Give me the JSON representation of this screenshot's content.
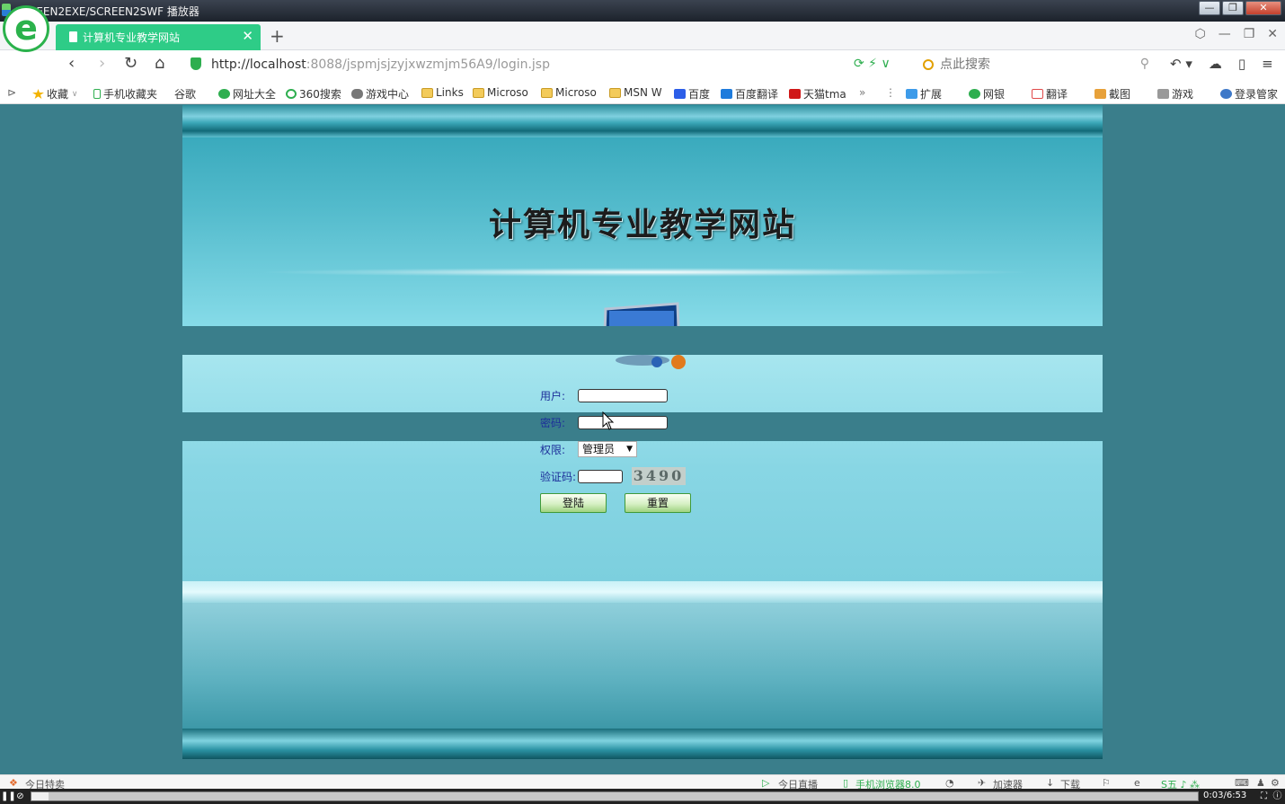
{
  "window": {
    "title": "SCREEN2EXE/SCREEN2SWF 播放器",
    "minimize": "—",
    "restore": "❐",
    "close": "✕"
  },
  "tabs": [
    {
      "title": "计算机专业教学网站",
      "close": "✕",
      "active": true
    }
  ],
  "new_tab": "+",
  "browser_logo": "e",
  "tab_icons": [
    "shirt-icon",
    "minimize-icon",
    "restore-icon",
    "close-icon"
  ],
  "nav": {
    "back": "‹",
    "forward": "›",
    "refresh": "↻",
    "home": "⌂",
    "url_host": "http://localhost",
    "url_rest": ":8088/jspmjsjzyjxwzmjm56A9/login.jsp",
    "url_tools": "⟳ ⚡  ∨",
    "search_placeholder": "点此搜索",
    "search_icon": "⚲",
    "undo": "↶ ▾",
    "cloud": "☁",
    "phone": "▯",
    "menu": "≡"
  },
  "bookmarks": [
    {
      "label": "收藏",
      "icon": "star",
      "suffix": "∨"
    },
    {
      "label": "手机收藏夹",
      "icon": "phone"
    },
    {
      "label": "谷歌",
      "icon": "page"
    },
    {
      "label": "网址大全",
      "icon": "globe"
    },
    {
      "label": "360搜索",
      "icon": "ring"
    },
    {
      "label": "游戏中心",
      "icon": "game"
    },
    {
      "label": "Links",
      "icon": "folder"
    },
    {
      "label": "Microso",
      "icon": "folder"
    },
    {
      "label": "Microso",
      "icon": "folder"
    },
    {
      "label": "MSN W",
      "icon": "folder"
    },
    {
      "label": "百度",
      "icon": "paw"
    },
    {
      "label": "百度翻译",
      "icon": "yi"
    },
    {
      "label": "天猫tma",
      "icon": "tm"
    }
  ],
  "bookmarks_more": "»",
  "bookmark_tools": [
    {
      "label": "扩展",
      "icon": "ext"
    },
    {
      "label": "网银",
      "icon": "bank"
    },
    {
      "label": "翻译",
      "icon": "fy"
    },
    {
      "label": "截图",
      "icon": "cut"
    },
    {
      "label": "游戏",
      "icon": "game2"
    },
    {
      "label": "登录管家",
      "icon": "key"
    }
  ],
  "site": {
    "title": "计算机专业教学网站"
  },
  "login_form": {
    "user_label": "用户:",
    "user_value": "",
    "password_label": "密码:",
    "password_value": "",
    "role_label": "权限:",
    "role_value": "管理员",
    "role_arrow": "▼",
    "captcha_label": "验证码:",
    "captcha_value": "",
    "captcha_text": "3490",
    "login_button": "登陆",
    "reset_button": "重置"
  },
  "status_bar": {
    "left": "今日特卖",
    "live": "今日直播",
    "mobile": "手机浏览器8.0",
    "accelerator": "加速器",
    "download": "下载"
  },
  "player": {
    "pause": "❚❚",
    "stop": "⊘",
    "progress": 0.0076,
    "time": "0:03/6:53",
    "fullscreen": "⛶",
    "info": "ⓘ"
  }
}
